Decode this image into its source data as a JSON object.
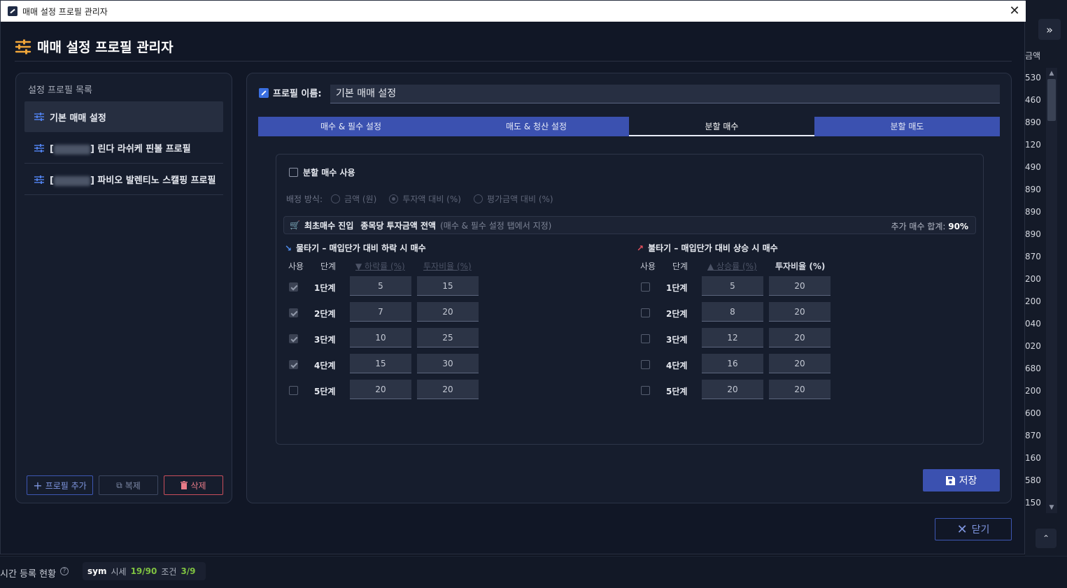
{
  "window": {
    "title": "매매 설정 프로필 관리자",
    "close_glyph": "✕"
  },
  "header": {
    "title": "매매 설정 프로필 관리자"
  },
  "sidebar": {
    "title": "설정 프로필 목록",
    "items": [
      {
        "label": "기본 매매 설정",
        "prefix": "",
        "active": true
      },
      {
        "prefix": "[",
        "label": "] 린다 라쉬케 핀볼 프로필",
        "active": false
      },
      {
        "prefix": "[",
        "label": "] 파비오 발렌티노 스캘핑 프로필",
        "active": false
      }
    ],
    "add_label": "프로필 추가",
    "copy_label": "복제",
    "delete_label": "삭제"
  },
  "profile": {
    "name_label": "프로필 이름:",
    "name_value": "기본 매매 설정"
  },
  "tabs": [
    {
      "label": "매수 & 필수 설정"
    },
    {
      "label": "매도 & 청산 설정"
    },
    {
      "label": "분할 매수",
      "active": true
    },
    {
      "label": "분할 매도"
    }
  ],
  "split": {
    "use_label": "분할 매수 사용",
    "alloc_label": "배정 방식:",
    "alloc_options": [
      "금액 (원)",
      "투자액 대비 (%)",
      "평가금액 대비 (%)"
    ],
    "alloc_selected": 1,
    "info_bold": "최초매수 진입",
    "info_bold2": "종목당 투자금액 전액",
    "info_hint": "(매수 & 필수 설정 탭에서 지정)",
    "info_total_label": "추가 매수 합계:",
    "info_total_value": "90%"
  },
  "down": {
    "title": "물타기 – 매입단가 대비 하락 시 매수",
    "col_use": "사용",
    "col_step": "단계",
    "col_rate": "▼ 하락률 (%)",
    "col_ratio": "투자비율 (%)",
    "rows": [
      {
        "step": "1단계",
        "rate": "5",
        "ratio": "15",
        "on": true
      },
      {
        "step": "2단계",
        "rate": "7",
        "ratio": "20",
        "on": true
      },
      {
        "step": "3단계",
        "rate": "10",
        "ratio": "25",
        "on": true
      },
      {
        "step": "4단계",
        "rate": "15",
        "ratio": "30",
        "on": true
      },
      {
        "step": "5단계",
        "rate": "20",
        "ratio": "20",
        "on": false
      }
    ]
  },
  "up": {
    "title": "불타기 – 매입단가 대비 상승 시 매수",
    "col_use": "사용",
    "col_step": "단계",
    "col_rate": "▲ 상승률 (%)",
    "col_ratio": "투자비율 (%)",
    "rows": [
      {
        "step": "1단계",
        "rate": "5",
        "ratio": "20",
        "on": false
      },
      {
        "step": "2단계",
        "rate": "8",
        "ratio": "20",
        "on": false
      },
      {
        "step": "3단계",
        "rate": "12",
        "ratio": "20",
        "on": false
      },
      {
        "step": "4단계",
        "rate": "16",
        "ratio": "20",
        "on": false
      },
      {
        "step": "5단계",
        "rate": "20",
        "ratio": "20",
        "on": false
      }
    ]
  },
  "buttons": {
    "save": "저장",
    "close": "닫기"
  },
  "background": {
    "col_head": "금액",
    "values": [
      "530",
      "460",
      "890",
      "120",
      "490",
      "890",
      "890",
      "890",
      "870",
      "200",
      "200",
      "040",
      "020",
      "680",
      "200",
      "600",
      "870",
      "160",
      "580",
      "150"
    ],
    "expand_glyph": "»",
    "up_glyph": "⌃"
  },
  "status": {
    "label": "시간 등록 현황",
    "help": "?",
    "sym": "sym",
    "price_label": "시세",
    "price_value": "19/90",
    "cond_label": "조건",
    "cond_value": "3/9"
  },
  "colors": {
    "accent": "#3b51b0",
    "orange": "#f0a63a",
    "danger": "#c94e5c",
    "green": "#7fc241"
  }
}
